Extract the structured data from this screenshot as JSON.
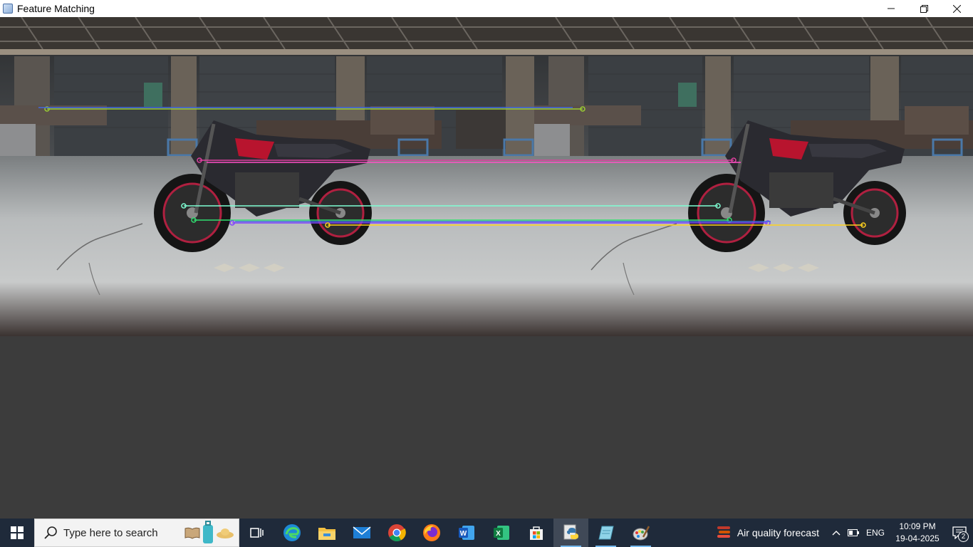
{
  "window": {
    "title": "Feature Matching",
    "controls": {
      "minimize_icon": "minimize-icon",
      "restore_icon": "restore-icon",
      "close_icon": "close-icon"
    }
  },
  "canvas": {
    "description_icon": "matched-images",
    "match_line_colors": [
      "#9acd32",
      "#4169e1",
      "#e040a0",
      "#ffd21f",
      "#7fffd4",
      "#2ee070",
      "#8040ff",
      "#ff50c8"
    ]
  },
  "taskbar": {
    "search_placeholder": "Type here to search",
    "apps": [
      {
        "name": "task-view-icon"
      },
      {
        "name": "edge-icon"
      },
      {
        "name": "file-explorer-icon"
      },
      {
        "name": "mail-icon"
      },
      {
        "name": "chrome-icon"
      },
      {
        "name": "firefox-icon"
      },
      {
        "name": "word-icon"
      },
      {
        "name": "excel-icon"
      },
      {
        "name": "store-icon"
      },
      {
        "name": "python-icon"
      },
      {
        "name": "notepad-icon"
      },
      {
        "name": "paint-icon"
      }
    ],
    "weather_text": "Air quality forecast",
    "language": "ENG",
    "time": "10:09 PM",
    "date": "19-04-2025",
    "notification_count": "2"
  },
  "colors": {
    "taskbar_bg": "#1f2a3a",
    "window_bg": "#3c3c3c",
    "accent": "#76b9ed"
  }
}
